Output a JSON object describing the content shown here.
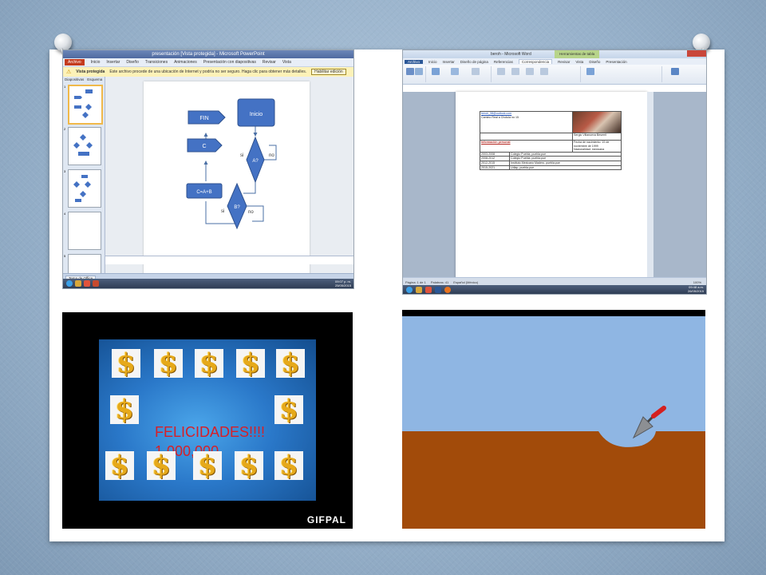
{
  "panels": {
    "powerpoint": {
      "window_title": "presentación [Vista protegida] - Microsoft PowerPoint",
      "ribbon_tabs": [
        "Archivo",
        "Inicio",
        "Insertar",
        "Diseño",
        "Transiciones",
        "Animaciones",
        "Presentación con diapositivas",
        "Revisar",
        "Vista"
      ],
      "protected_view": {
        "label": "Vista protegida",
        "message": "Este archivo procede de una ubicación de Internet y podría no ser seguro. Haga clic para obtener más detalles.",
        "button": "Habilitar edición"
      },
      "pane_tabs": [
        "Diapositivas",
        "Esquema"
      ],
      "slide_numbers": [
        "1",
        "2",
        "3",
        "4",
        "5"
      ],
      "flowchart": {
        "start": "Inicio",
        "end": "FIN",
        "process_c": "C",
        "process_sum": "C=A+B",
        "decision_a": "A?",
        "decision_b": "B?",
        "yes_a": "si",
        "no_a": "no",
        "yes_b": "si",
        "no_b": "no"
      },
      "status_theme": "Tema de Office",
      "clock_time": "09:07 p. m.",
      "clock_date": "25/05/2015"
    },
    "word": {
      "window_title": "beroh - Microsoft Word",
      "context_tab": "Herramientas de tabla",
      "ribbon_tabs": [
        "Archivo",
        "Inicio",
        "Insertar",
        "Diseño de página",
        "Referencias",
        "Correspondencia",
        "Revisar",
        "Vista",
        "Diseño",
        "Presentación"
      ],
      "active_tab": "Correspondencia",
      "cv": {
        "email": "beroh_98@outlook.com",
        "address": "Camino Real a Cholula no 15",
        "name": "Sergio Villanueva Beserril",
        "info_heading": "Información personal",
        "birth": "Fecha de nacimiento: 19 de noviembre de 1999",
        "nationality": "Nacionalidad: mexicana",
        "education": [
          {
            "years": "2003-2008",
            "school": "Colegio Puebla, puebla.pue"
          },
          {
            "years": "2008-2012",
            "school": "Colegio Puebla, puebla.pue"
          },
          {
            "years": "2012-2015",
            "school": "Instituto Mexicano Madero, puebla.pue"
          },
          {
            "years": "2015-2021",
            "school": "Udlap, puebla.pue"
          }
        ]
      },
      "status_page": "Página: 1 de 1",
      "status_words": "Palabras: 41",
      "status_lang": "Español (México)",
      "zoom": "100%",
      "clock_time": "09:48 a.m.",
      "clock_date": "26/05/2015"
    },
    "felicidades": {
      "line1": "FELICIDADES!!!!",
      "line2": "1,000,000",
      "dollar_glyph": "$",
      "watermark": "GIFPAL"
    },
    "animation": {
      "sky_color": "#8fb6e3",
      "ground_color": "#a24b0a"
    }
  }
}
